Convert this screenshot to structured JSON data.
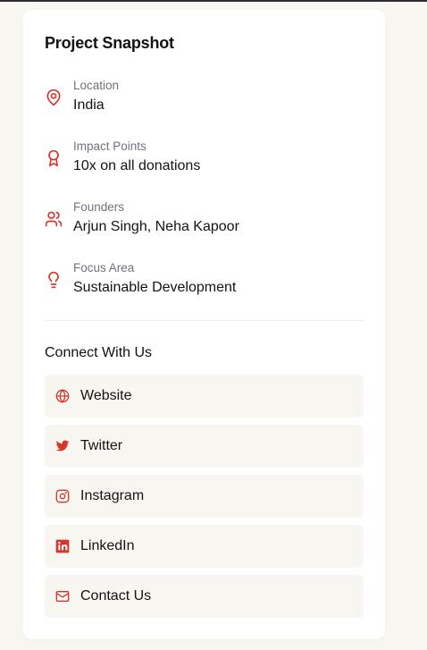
{
  "card": {
    "title": "Project Snapshot",
    "accent_color": "#d9362b",
    "details": [
      {
        "icon": "map-pin-icon",
        "label": "Location",
        "value": "India"
      },
      {
        "icon": "award-icon",
        "label": "Impact Points",
        "value": "10x on all donations"
      },
      {
        "icon": "users-icon",
        "label": "Founders",
        "value": "Arjun Singh, Neha Kapoor"
      },
      {
        "icon": "lightbulb-icon",
        "label": "Focus Area",
        "value": "Sustainable Development"
      }
    ],
    "connect": {
      "heading": "Connect With Us",
      "links": [
        {
          "icon": "globe-icon",
          "label": "Website"
        },
        {
          "icon": "twitter-icon",
          "label": "Twitter"
        },
        {
          "icon": "instagram-icon",
          "label": "Instagram"
        },
        {
          "icon": "linkedin-icon",
          "label": "LinkedIn"
        },
        {
          "icon": "mail-icon",
          "label": "Contact Us"
        }
      ]
    }
  }
}
